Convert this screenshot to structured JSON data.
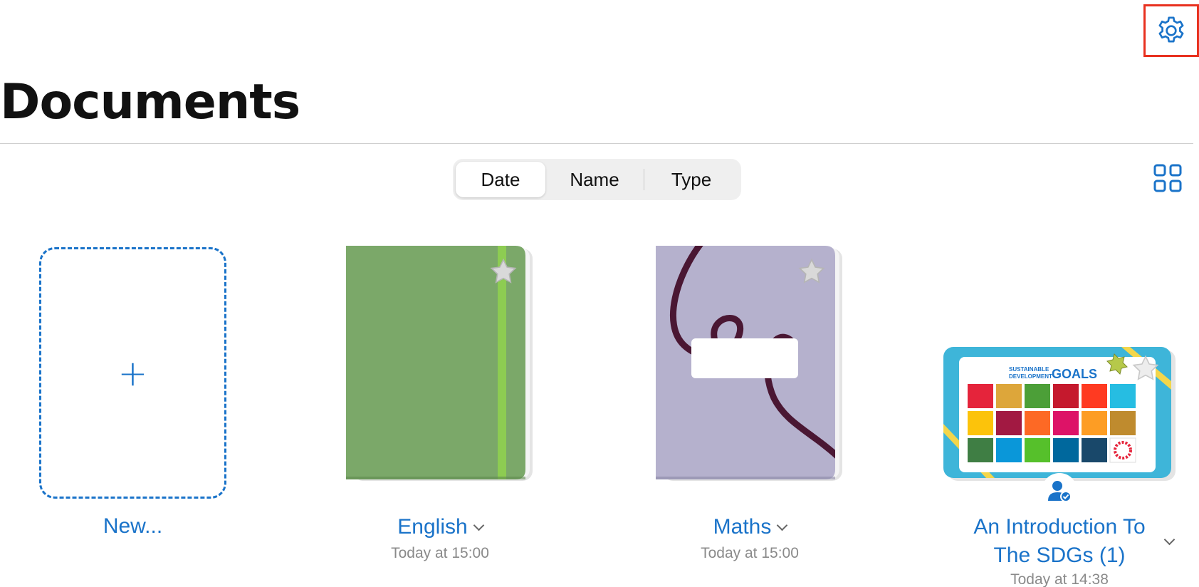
{
  "header": {
    "title": "Documents",
    "settings_icon": "gear-icon"
  },
  "sort": {
    "options": [
      "Date",
      "Name",
      "Type"
    ],
    "selected": "Date"
  },
  "view_toggle_icon": "grid-view-icon",
  "new_card": {
    "label": "New..."
  },
  "documents": [
    {
      "title": "English",
      "date": "Today at 15:00",
      "cover": "green-notebook",
      "favorite": false
    },
    {
      "title": "Maths",
      "date": "Today at 15:00",
      "cover": "purple-notebook",
      "favorite": false
    },
    {
      "title_line1": "An Introduction To",
      "title_line2": "The SDGs (1)",
      "date": "Today at 14:38",
      "cover": "sustainable-development-goals",
      "shared": true,
      "favorite": false
    }
  ],
  "sdg_cover": {
    "heading_line1": "SUSTAINABLE",
    "heading_line2": "DEVELOPMENT",
    "heading_goals": "GOALS"
  },
  "colors": {
    "accent": "#1a73c9",
    "settings_highlight": "#e8311f",
    "english_cover": "#7ba869",
    "english_band": "#8dcc52",
    "maths_cover": "#b5b1cd",
    "maths_ribbon": "#4a1733",
    "sdg_border": "#3eb5d9"
  }
}
